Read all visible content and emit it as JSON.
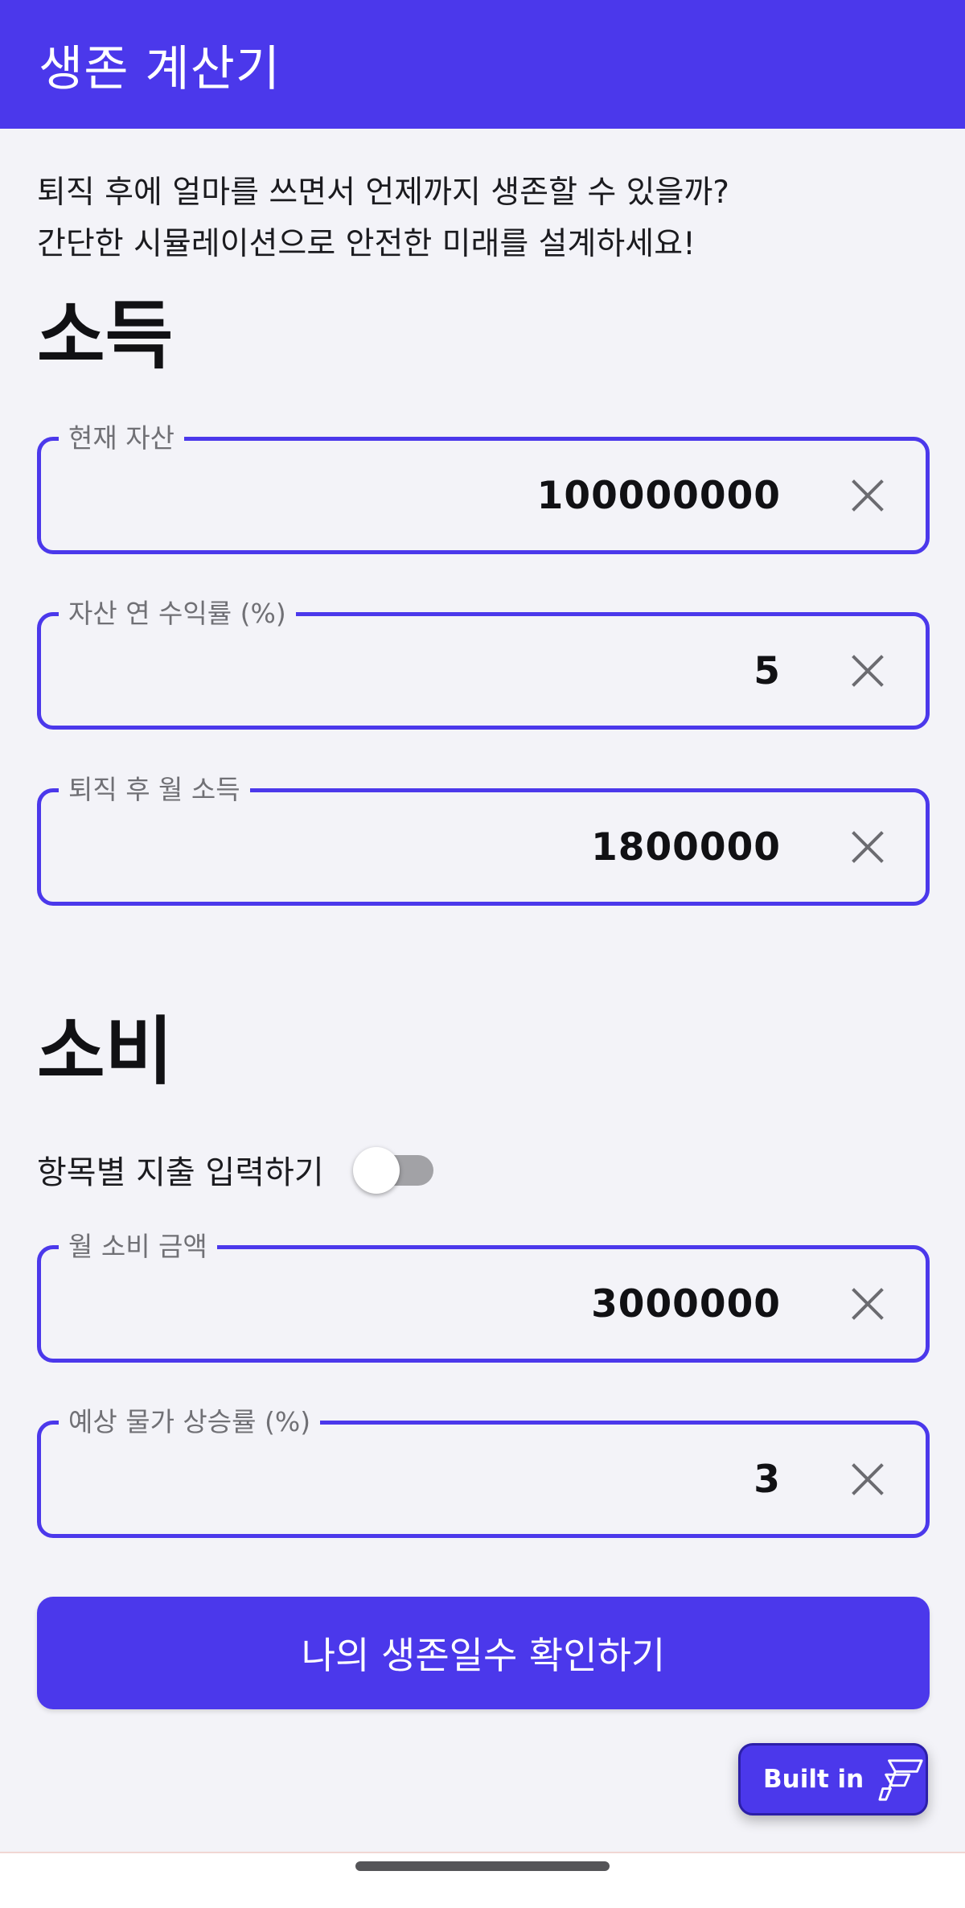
{
  "app_bar": {
    "title": "생존 계산기"
  },
  "intro": {
    "line1": "퇴직 후에 얼마를 쓰면서 언제까지 생존할 수 있을까?",
    "line2": "간단한 시뮬레이션으로 안전한 미래를 설계하세요!"
  },
  "income": {
    "title": "소득",
    "fields": [
      {
        "label": "현재 자산",
        "value": "100000000"
      },
      {
        "label": "자산 연 수익률 (%)",
        "value": "5"
      },
      {
        "label": "퇴직 후 월 소득",
        "value": "1800000"
      }
    ]
  },
  "spending": {
    "title": "소비",
    "toggle_label": "항목별 지출 입력하기",
    "toggle_on": false,
    "fields": [
      {
        "label": "월 소비 금액",
        "value": "3000000"
      },
      {
        "label": "예상 물가 상승률 (%)",
        "value": "3"
      }
    ]
  },
  "primary_button": {
    "label": "나의 생존일수 확인하기"
  },
  "badge": {
    "label": "Built in"
  },
  "icons": {
    "clear": "close-icon",
    "badge_logo": "flutterflow-logo-icon"
  },
  "colors": {
    "accent": "#4b38eb",
    "background": "#f3f3f8",
    "label_gray": "#707075",
    "switch_track_off": "#a2a2a6"
  }
}
